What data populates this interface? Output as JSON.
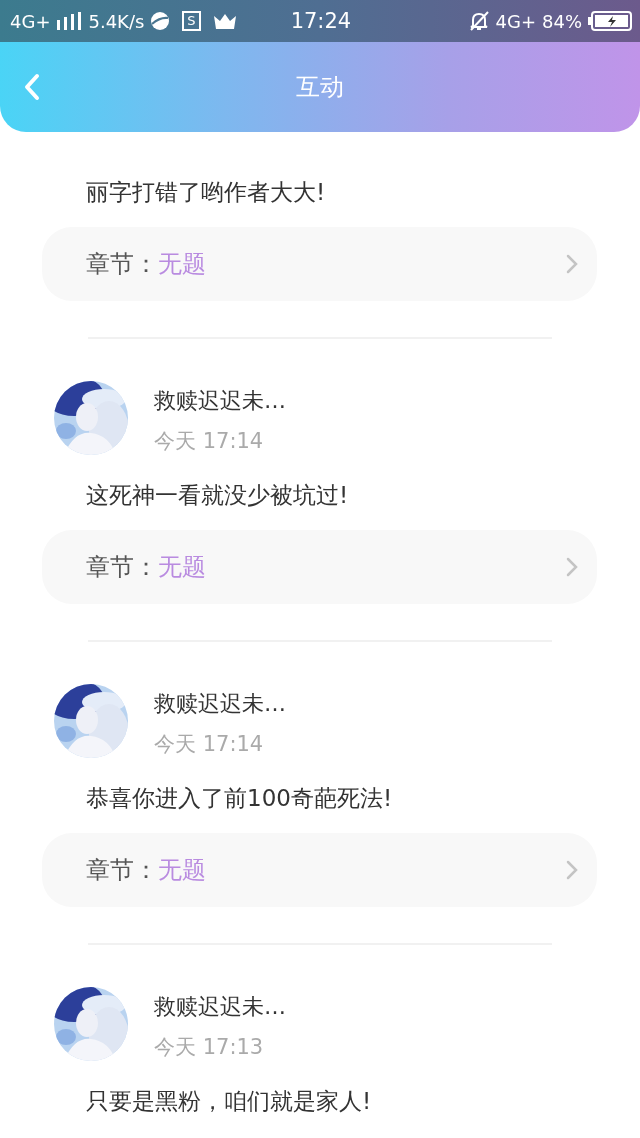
{
  "status_bar": {
    "network": "4G+",
    "speed": "5.4K/s",
    "app_badge": "S",
    "time": "17:24",
    "network_right": "4G+",
    "battery": "84%"
  },
  "header": {
    "title": "互动"
  },
  "comments": [
    {
      "text": "丽字打错了哟作者大大!",
      "chapter_label": "章节：",
      "chapter": "无题"
    },
    {
      "author": "救赎迟迟未…",
      "time": "今天 17:14",
      "text": "这死神一看就没少被坑过!",
      "chapter_label": "章节：",
      "chapter": "无题"
    },
    {
      "author": "救赎迟迟未…",
      "time": "今天 17:14",
      "text": "恭喜你进入了前100奇葩死法!",
      "chapter_label": "章节：",
      "chapter": "无题"
    },
    {
      "author": "救赎迟迟未…",
      "time": "今天 17:13",
      "text": "只要是黑粉，咱们就是家人!"
    }
  ]
}
